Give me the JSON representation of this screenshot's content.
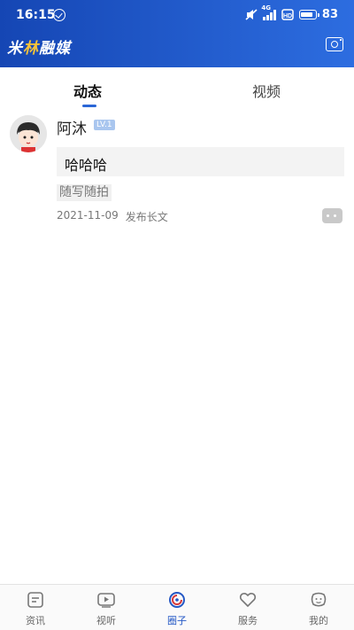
{
  "status_bar": {
    "time": "16:15",
    "network": "4G",
    "battery": "83"
  },
  "header": {
    "logo_part1": "米",
    "logo_part2": "林",
    "logo_part3": "融媒"
  },
  "tabs": [
    {
      "label": "动态",
      "active": true
    },
    {
      "label": "视频",
      "active": false
    }
  ],
  "post": {
    "username": "阿沐",
    "level": "LV.1",
    "content": "哈哈哈",
    "topic": "随写随拍",
    "date": "2021-11-09",
    "type": "发布长文"
  },
  "bottom_nav": [
    {
      "label": "资讯",
      "icon": "news-icon",
      "active": false
    },
    {
      "label": "视听",
      "icon": "video-play-icon",
      "active": false
    },
    {
      "label": "圈子",
      "icon": "circle-icon",
      "active": true
    },
    {
      "label": "服务",
      "icon": "heart-service-icon",
      "active": false
    },
    {
      "label": "我的",
      "icon": "profile-face-icon",
      "active": false
    }
  ],
  "colors": {
    "header_start": "#1546b4",
    "header_end": "#2d6de0",
    "accent": "#2458c5",
    "logo_highlight": "#f5c23a"
  }
}
